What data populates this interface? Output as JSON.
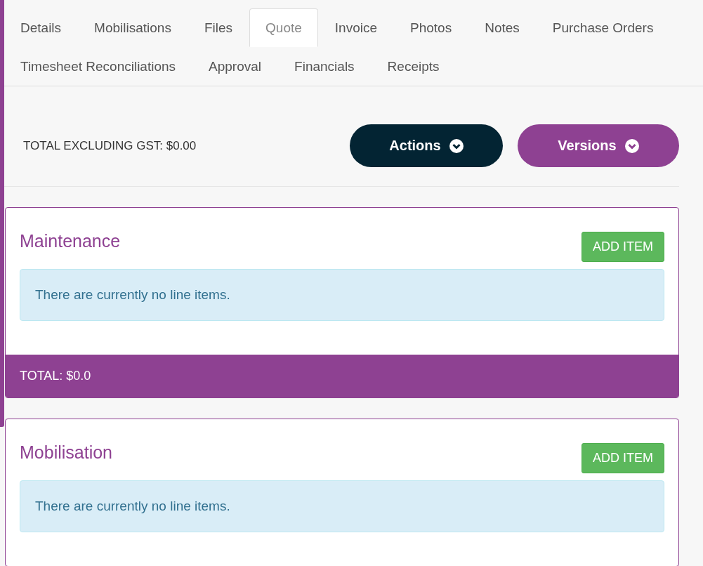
{
  "tabs": [
    {
      "label": "Details",
      "selected": false
    },
    {
      "label": "Mobilisations",
      "selected": false
    },
    {
      "label": "Files",
      "selected": false
    },
    {
      "label": "Quote",
      "selected": true
    },
    {
      "label": "Invoice",
      "selected": false
    },
    {
      "label": "Photos",
      "selected": false
    },
    {
      "label": "Notes",
      "selected": false
    },
    {
      "label": "Purchase Orders",
      "selected": false
    },
    {
      "label": "Timesheet Reconciliations",
      "selected": false
    },
    {
      "label": "Approval",
      "selected": false
    },
    {
      "label": "Financials",
      "selected": false
    },
    {
      "label": "Receipts",
      "selected": false
    }
  ],
  "summary": {
    "total_label": "TOTAL EXCLUDING GST: $0.00",
    "buttons": [
      {
        "label": "Actions",
        "kind": "dark"
      },
      {
        "label": "Versions",
        "kind": "purple"
      }
    ]
  },
  "sections": [
    {
      "title": "Maintenance",
      "add_button": "ADD ITEM",
      "message": "There are currently no line items.",
      "total": "TOTAL: $0.0"
    },
    {
      "title": "Mobilisation",
      "add_button": "ADD ITEM",
      "message": "There are currently no line items."
    }
  ]
}
